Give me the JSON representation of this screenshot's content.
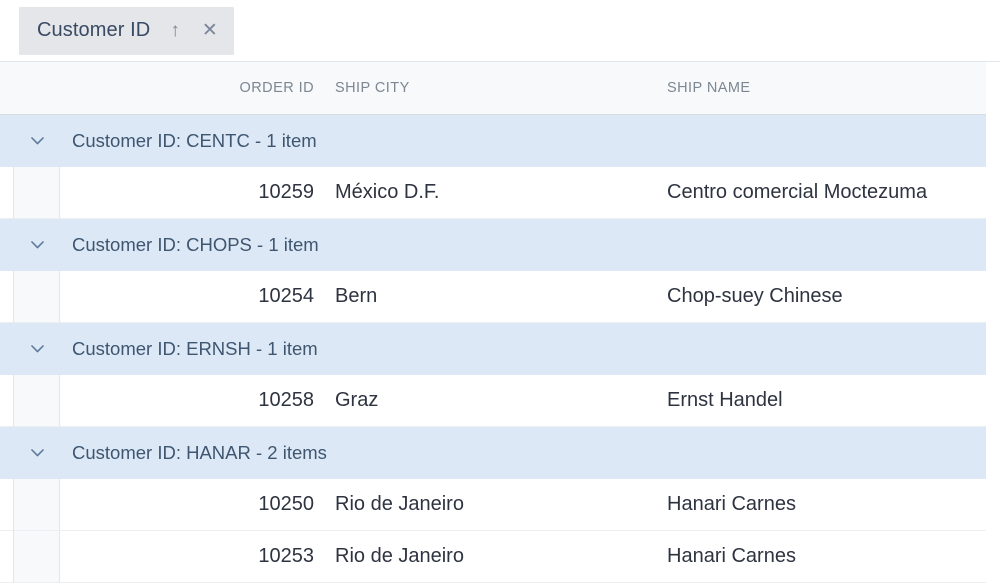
{
  "group_panel": {
    "chip": {
      "label": "Customer ID",
      "sort_icon": "arrow-up-icon",
      "sort_glyph": "↑",
      "close_glyph": "✕",
      "close_icon": "close-icon"
    }
  },
  "grid": {
    "columns": [
      {
        "key": "order_id",
        "header": "ORDER ID",
        "align": "right"
      },
      {
        "key": "ship_city",
        "header": "SHIP CITY",
        "align": "left"
      },
      {
        "key": "ship_name",
        "header": "SHIP NAME",
        "align": "left"
      }
    ],
    "group_field_label": "Customer ID",
    "expander_icon": "chevron-down-icon",
    "groups": [
      {
        "title": "Customer ID: CENTC - 1 item",
        "key": "CENTC",
        "count_label": "1 item",
        "expanded": true,
        "rows": [
          {
            "order_id": "10259",
            "ship_city": "México D.F.",
            "ship_name": "Centro comercial Moctezuma"
          }
        ]
      },
      {
        "title": "Customer ID: CHOPS - 1 item",
        "key": "CHOPS",
        "count_label": "1 item",
        "expanded": true,
        "rows": [
          {
            "order_id": "10254",
            "ship_city": "Bern",
            "ship_name": "Chop-suey Chinese"
          }
        ]
      },
      {
        "title": "Customer ID: ERNSH - 1 item",
        "key": "ERNSH",
        "count_label": "1 item",
        "expanded": true,
        "rows": [
          {
            "order_id": "10258",
            "ship_city": "Graz",
            "ship_name": "Ernst Handel"
          }
        ]
      },
      {
        "title": "Customer ID: HANAR - 2 items",
        "key": "HANAR",
        "count_label": "2 items",
        "expanded": true,
        "rows": [
          {
            "order_id": "10250",
            "ship_city": "Rio de Janeiro",
            "ship_name": "Hanari Carnes"
          },
          {
            "order_id": "10253",
            "ship_city": "Rio de Janeiro",
            "ship_name": "Hanari Carnes"
          }
        ]
      }
    ]
  },
  "colors": {
    "group_row_bg": "#dce8f6",
    "header_bg": "#f7f9fa",
    "chip_bg": "#e4e6e9",
    "border": "#e3e6ea",
    "text": "#2e3340",
    "muted_text": "#7d8794",
    "group_text": "#3f5670"
  }
}
